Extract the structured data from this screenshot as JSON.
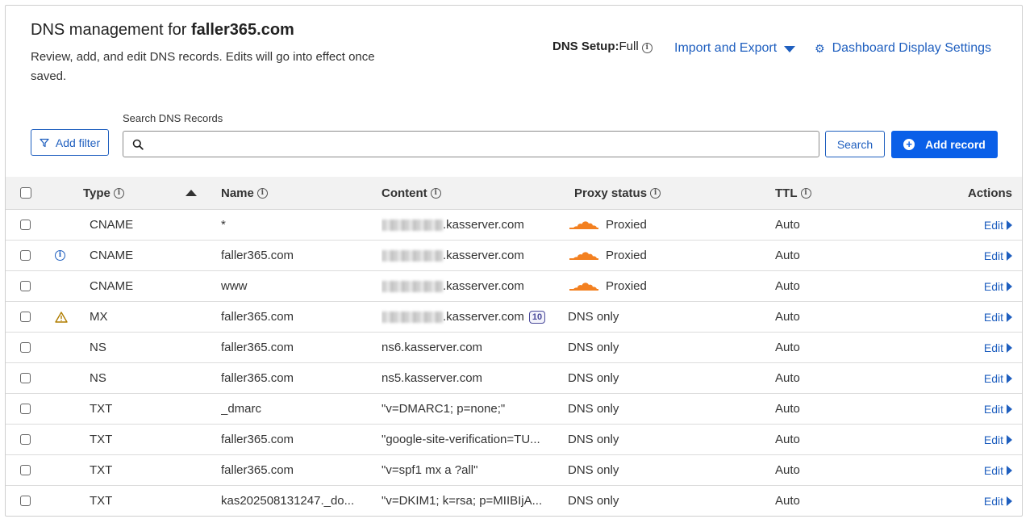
{
  "header": {
    "title_prefix": "DNS management for",
    "domain": "faller365.com",
    "description": "Review, add, and edit DNS records. Edits will go into effect once saved.",
    "dns_setup_label": "DNS Setup:",
    "dns_setup_value": "Full",
    "import_export_label": "Import and Export",
    "dashboard_settings_label": "Dashboard Display Settings"
  },
  "toolbar": {
    "add_filter_label": "Add filter",
    "search_label": "Search DNS Records",
    "search_value": "",
    "search_button_label": "Search",
    "add_record_label": "Add record"
  },
  "table": {
    "columns": {
      "type": "Type",
      "name": "Name",
      "content": "Content",
      "proxy": "Proxy status",
      "ttl": "TTL",
      "actions": "Actions"
    },
    "rows": [
      {
        "flag": "",
        "type": "CNAME",
        "name": "*",
        "content": ".kasserver.com",
        "redacted": true,
        "badge": "",
        "proxy": "Proxied",
        "proxied": true,
        "ttl": "Auto",
        "action": "Edit"
      },
      {
        "flag": "info",
        "type": "CNAME",
        "name": "faller365.com",
        "content": ".kasserver.com",
        "redacted": true,
        "badge": "",
        "proxy": "Proxied",
        "proxied": true,
        "ttl": "Auto",
        "action": "Edit"
      },
      {
        "flag": "",
        "type": "CNAME",
        "name": "www",
        "content": ".kasserver.com",
        "redacted": true,
        "badge": "",
        "proxy": "Proxied",
        "proxied": true,
        "ttl": "Auto",
        "action": "Edit"
      },
      {
        "flag": "warning",
        "type": "MX",
        "name": "faller365.com",
        "content": ".kasserver.com",
        "redacted": true,
        "badge": "10",
        "proxy": "DNS only",
        "proxied": false,
        "ttl": "Auto",
        "action": "Edit"
      },
      {
        "flag": "",
        "type": "NS",
        "name": "faller365.com",
        "content": "ns6.kasserver.com",
        "redacted": false,
        "badge": "",
        "proxy": "DNS only",
        "proxied": false,
        "ttl": "Auto",
        "action": "Edit"
      },
      {
        "flag": "",
        "type": "NS",
        "name": "faller365.com",
        "content": "ns5.kasserver.com",
        "redacted": false,
        "badge": "",
        "proxy": "DNS only",
        "proxied": false,
        "ttl": "Auto",
        "action": "Edit"
      },
      {
        "flag": "",
        "type": "TXT",
        "name": "_dmarc",
        "content": "\"v=DMARC1; p=none;\"",
        "redacted": false,
        "badge": "",
        "proxy": "DNS only",
        "proxied": false,
        "ttl": "Auto",
        "action": "Edit"
      },
      {
        "flag": "",
        "type": "TXT",
        "name": "faller365.com",
        "content": "\"google-site-verification=TU...",
        "redacted": false,
        "badge": "",
        "proxy": "DNS only",
        "proxied": false,
        "ttl": "Auto",
        "action": "Edit"
      },
      {
        "flag": "",
        "type": "TXT",
        "name": "faller365.com",
        "content": "\"v=spf1 mx a ?all\"",
        "redacted": false,
        "badge": "",
        "proxy": "DNS only",
        "proxied": false,
        "ttl": "Auto",
        "action": "Edit"
      },
      {
        "flag": "",
        "type": "TXT",
        "name": "kas202508131247._do...",
        "content": "\"v=DKIM1; k=rsa; p=MIIBIjA...",
        "redacted": false,
        "badge": "",
        "proxy": "DNS only",
        "proxied": false,
        "ttl": "Auto",
        "action": "Edit"
      }
    ]
  },
  "colors": {
    "accent": "#1f5fbf",
    "primary_button": "#0a5fe8",
    "proxied_cloud": "#f38020",
    "warning": "#b07d00"
  }
}
